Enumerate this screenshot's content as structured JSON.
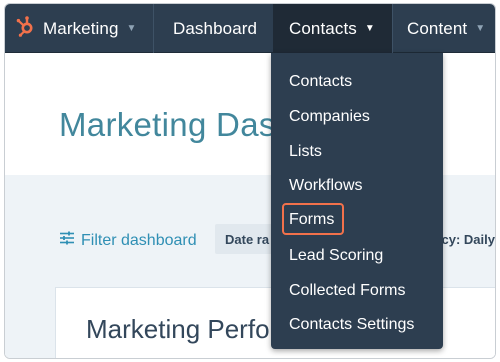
{
  "topnav": {
    "items": [
      {
        "label": "Marketing"
      },
      {
        "label": "Dashboard"
      },
      {
        "label": "Contacts"
      },
      {
        "label": "Content"
      }
    ]
  },
  "page": {
    "title": "Marketing Das",
    "filter_label": "Filter dashboard",
    "date_chip": "Date ra",
    "frequency_chip": "ncy: Daily",
    "card_title": "Marketing Perfo"
  },
  "dropdown": {
    "items": [
      {
        "label": "Contacts"
      },
      {
        "label": "Companies"
      },
      {
        "label": "Lists"
      },
      {
        "label": "Workflows"
      },
      {
        "label": "Forms",
        "highlighted": true
      },
      {
        "label": "Lead Scoring"
      },
      {
        "label": "Collected Forms"
      },
      {
        "label": "Contacts Settings"
      }
    ]
  },
  "colors": {
    "nav_bg": "#2d3e50",
    "nav_active_bg": "#1f2a36",
    "brand_orange": "#f2714b",
    "link_blue": "#2f8fb4",
    "title_teal": "#42879c",
    "highlight_border": "#f2714b"
  },
  "icons": {
    "logo": "hubspot-sprocket-icon",
    "caret": "caret-down-icon",
    "filter": "sliders-icon"
  }
}
